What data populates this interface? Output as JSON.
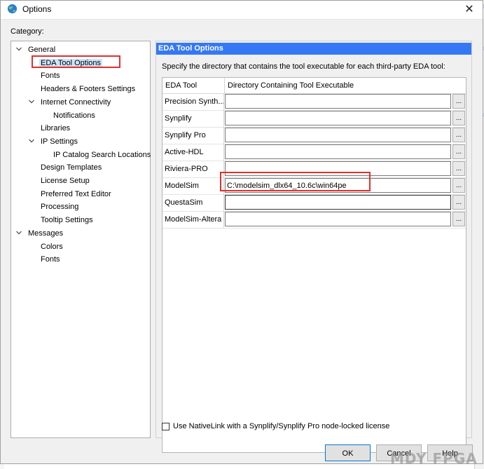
{
  "window": {
    "title": "Options",
    "close_glyph": "✕",
    "icon": "globe-icon"
  },
  "category_label": "Category:",
  "tree": {
    "items": [
      {
        "label": "General",
        "level": 0,
        "expander": "expanded"
      },
      {
        "label": "EDA Tool Options",
        "level": 1,
        "selected": true
      },
      {
        "label": "Fonts",
        "level": 1
      },
      {
        "label": "Headers & Footers Settings",
        "level": 1
      },
      {
        "label": "Internet Connectivity",
        "level": 1,
        "expander": "expanded"
      },
      {
        "label": "Notifications",
        "level": 2
      },
      {
        "label": "Libraries",
        "level": 1
      },
      {
        "label": "IP Settings",
        "level": 1,
        "expander": "expanded"
      },
      {
        "label": "IP Catalog Search Locations",
        "level": 2
      },
      {
        "label": "Design Templates",
        "level": 1
      },
      {
        "label": "License Setup",
        "level": 1
      },
      {
        "label": "Preferred Text Editor",
        "level": 1
      },
      {
        "label": "Processing",
        "level": 1
      },
      {
        "label": "Tooltip Settings",
        "level": 1
      },
      {
        "label": "Messages",
        "level": 0,
        "expander": "expanded"
      },
      {
        "label": "Colors",
        "level": 1
      },
      {
        "label": "Fonts",
        "level": 1
      }
    ]
  },
  "panel": {
    "header": "EDA Tool Options",
    "description": "Specify the directory that contains the tool executable for each third-party EDA tool:",
    "columns": [
      "EDA Tool",
      "Directory Containing Tool Executable"
    ],
    "rows": [
      {
        "tool": "Precision Synth...",
        "path": ""
      },
      {
        "tool": "Synplify",
        "path": ""
      },
      {
        "tool": "Synplify Pro",
        "path": ""
      },
      {
        "tool": "Active-HDL",
        "path": ""
      },
      {
        "tool": "Riviera-PRO",
        "path": ""
      },
      {
        "tool": "ModelSim",
        "path": "C:\\modelsim_dlx64_10.6c\\win64pe"
      },
      {
        "tool": "QuestaSim",
        "path": ""
      },
      {
        "tool": "ModelSim-Altera",
        "path": ""
      }
    ],
    "browse_label": "...",
    "nativelink_label": "Use NativeLink with a Synplify/Synplify Pro node-locked license",
    "nativelink_checked": false
  },
  "buttons": {
    "ok": "OK",
    "cancel": "Cancel",
    "help": "Help"
  },
  "watermark": "MDY FPGA",
  "colors": {
    "header_blue": "#3478f6",
    "annotation_red": "#e03030",
    "selection": "#cce4f7"
  }
}
